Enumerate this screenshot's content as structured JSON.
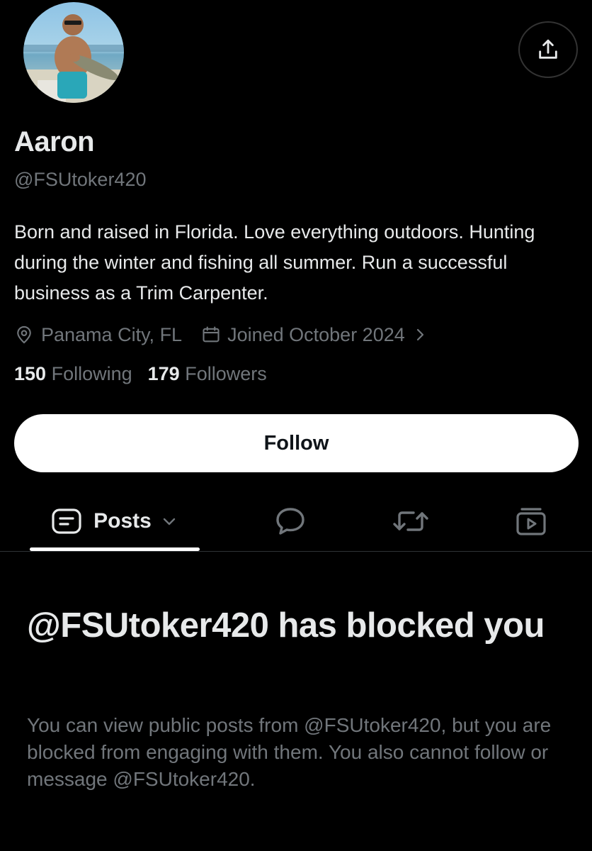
{
  "profile": {
    "display_name": "Aaron",
    "handle": "@FSUtoker420",
    "bio": "Born and raised in Florida. Love everything outdoors. Hunting during the winter and fishing all summer. Run a successful business as a Trim Carpenter.",
    "location": "Panama City, FL",
    "joined": "Joined October 2024",
    "following_count": "150",
    "following_label": "Following",
    "followers_count": "179",
    "followers_label": "Followers"
  },
  "actions": {
    "follow_label": "Follow"
  },
  "tabs": {
    "posts_label": "Posts"
  },
  "blocked": {
    "title": "@FSUtoker420 has blocked you",
    "message": "You can view public posts from @FSUtoker420, but you are blocked from engaging with them. You also cannot follow or message @FSUtoker420."
  },
  "icons": {
    "share": "share-icon",
    "location": "location-pin-icon",
    "calendar": "calendar-icon",
    "chevron": "chevron-right-icon",
    "posts": "posts-icon",
    "replies": "reply-bubble-icon",
    "reposts": "repost-icon",
    "media": "video-media-icon"
  },
  "colors": {
    "background": "#000000",
    "text_primary": "#e7e9ea",
    "text_secondary": "#71767b",
    "follow_button_bg": "#ffffff"
  }
}
